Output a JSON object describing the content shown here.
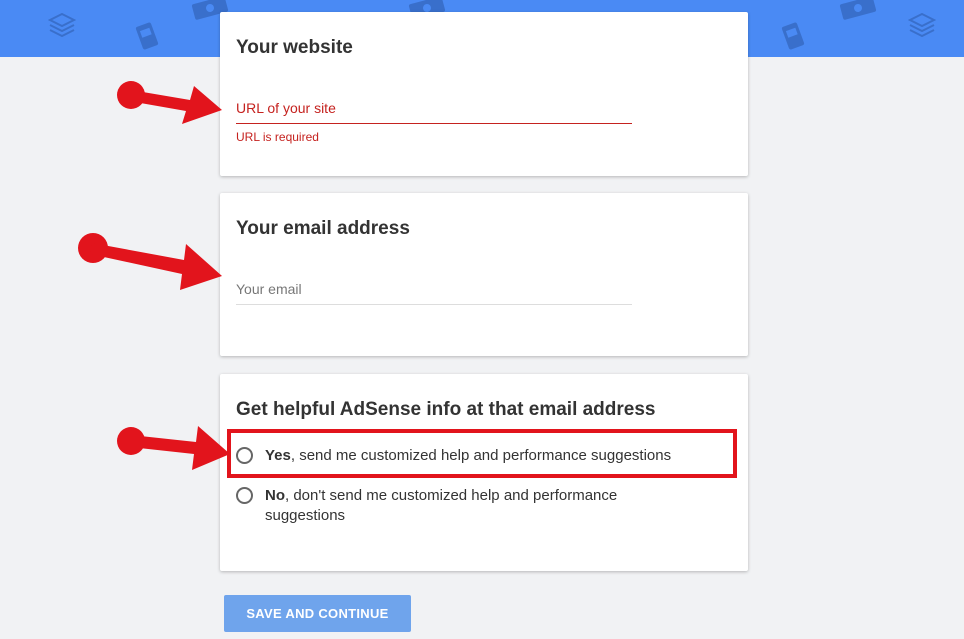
{
  "website_card": {
    "title": "Your website",
    "url_placeholder": "URL of your site",
    "error": "URL is required"
  },
  "email_card": {
    "title": "Your email address",
    "email_placeholder": "Your email"
  },
  "adsense_card": {
    "title": "Get helpful AdSense info at that email address",
    "yes_strong": "Yes",
    "yes_rest": ", send me customized help and performance suggestions",
    "no_strong": "No",
    "no_rest": ", don't send me customized help and performance suggestions"
  },
  "actions": {
    "save_label": "SAVE AND CONTINUE"
  },
  "colors": {
    "header_blue": "#4a8af4",
    "button_blue": "#6fa4ec",
    "error_red": "#c5221f",
    "annotation_red": "#e2141c"
  },
  "icons": [
    "layers-icon",
    "ad-sticker-icon",
    "money-icon",
    "annotation-arrow"
  ]
}
